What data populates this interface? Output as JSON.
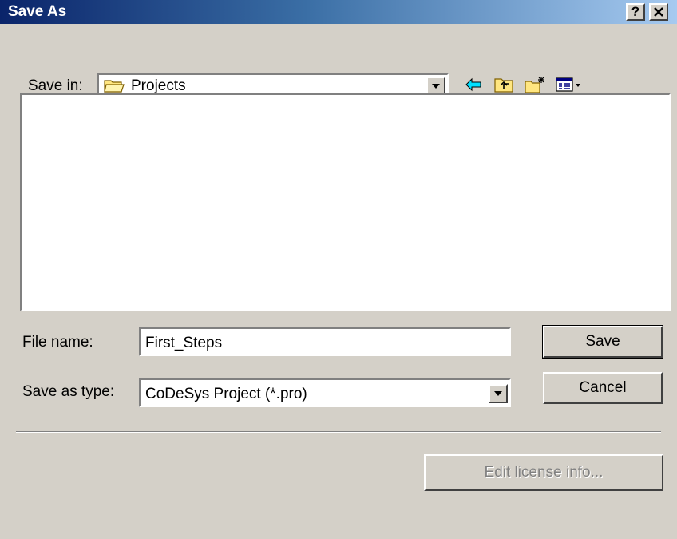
{
  "window": {
    "title": "Save As",
    "help_button": "?",
    "close_button": "✕"
  },
  "save_in": {
    "label": "Save in:",
    "value": "Projects",
    "icon": "folder-icon"
  },
  "toolbar": {
    "back_icon": "back-arrow-icon",
    "up_icon": "up-folder-icon",
    "new_folder_icon": "new-folder-icon",
    "view_menu_icon": "view-menu-icon"
  },
  "file_list": {
    "items": []
  },
  "file_name": {
    "label": "File name:",
    "value": "First_Steps"
  },
  "save_as_type": {
    "label": "Save as type:",
    "value": "CoDeSys Project (*.pro)"
  },
  "buttons": {
    "save": "Save",
    "cancel": "Cancel",
    "edit_license": "Edit license info..."
  },
  "colors": {
    "titlebar_start": "#0a246a",
    "titlebar_end": "#a6caf0",
    "dialog_face": "#d4d0c8"
  }
}
